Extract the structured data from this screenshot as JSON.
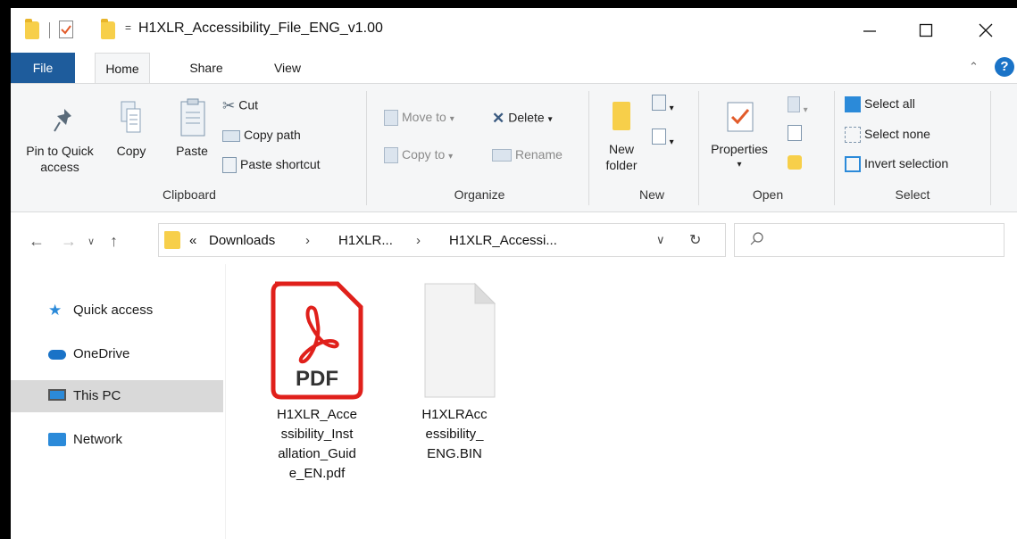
{
  "window": {
    "title": "H1XLR_Accessibility_File_ENG_v1.00",
    "quick_access_dropdown": "="
  },
  "tabs": [
    "File",
    "Home",
    "Share",
    "View"
  ],
  "ribbon": {
    "clipboard": {
      "pin_label_1": "Pin to Quick",
      "pin_label_2": "access",
      "copy": "Copy",
      "paste": "Paste",
      "cut": "Cut",
      "copy_path": "Copy path",
      "paste_shortcut": "Paste shortcut",
      "group": "Clipboard"
    },
    "organize": {
      "move_to": "Move to",
      "copy_to": "Copy to",
      "delete": "Delete",
      "rename": "Rename",
      "group": "Organize"
    },
    "new": {
      "new_folder_1": "New",
      "new_folder_2": "folder",
      "group": "New"
    },
    "open": {
      "properties": "Properties",
      "group": "Open"
    },
    "select": {
      "select_all": "Select all",
      "select_none": "Select none",
      "invert": "Invert selection",
      "group": "Select"
    }
  },
  "address": {
    "overflow": "«",
    "crumbs": [
      "Downloads",
      "H1XLR...",
      "H1XLR_Accessi..."
    ]
  },
  "nav_pane": {
    "items": [
      "Quick access",
      "OneDrive",
      "This PC",
      "Network"
    ],
    "selected": "This PC"
  },
  "files": [
    {
      "name_lines": [
        "H1XLR_Acce",
        "ssibility_Inst",
        "allation_Guid",
        "e_EN.pdf"
      ],
      "icon": "pdf-file-icon",
      "badge": "PDF"
    },
    {
      "name_lines": [
        "H1XLRAcc",
        "essibility_",
        "ENG.BIN"
      ],
      "icon": "generic-file-icon"
    }
  ],
  "colors": {
    "file_tab": "#1e5c9c",
    "folder": "#f7cf4a",
    "pdf_red": "#e0201b",
    "selected": "#d9d9d9",
    "accent_blue": "#1a73c7"
  }
}
